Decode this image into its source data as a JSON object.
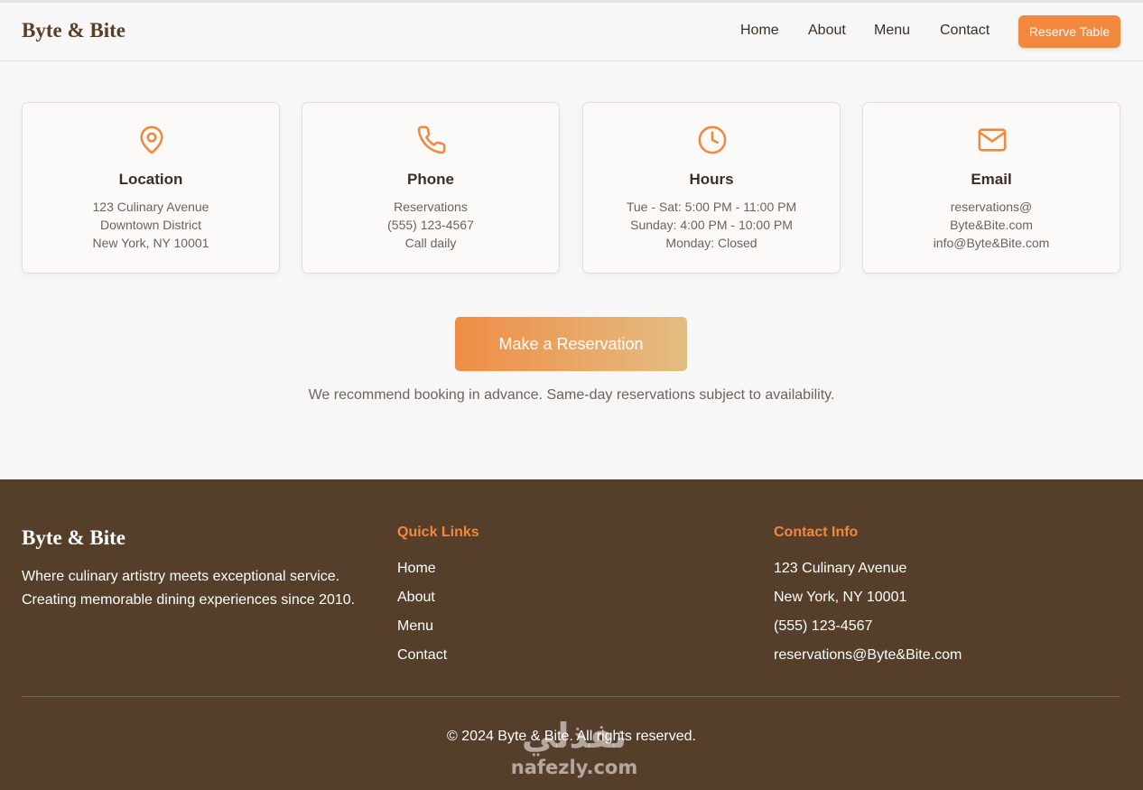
{
  "header": {
    "brand": "Byte & Bite",
    "nav": [
      "Home",
      "About",
      "Menu",
      "Contact"
    ],
    "reserve_label": "Reserve Table"
  },
  "cards": [
    {
      "icon": "map-pin-icon",
      "title": "Location",
      "lines": [
        "123 Culinary Avenue",
        "Downtown District",
        "New York, NY 10001"
      ]
    },
    {
      "icon": "phone-icon",
      "title": "Phone",
      "lines": [
        "Reservations",
        "(555) 123-4567",
        "Call daily"
      ]
    },
    {
      "icon": "clock-icon",
      "title": "Hours",
      "lines": [
        "Tue - Sat: 5:00 PM - 11:00 PM",
        "Sunday: 4:00 PM - 10:00 PM",
        "Monday: Closed"
      ]
    },
    {
      "icon": "mail-icon",
      "title": "Email",
      "lines": [
        "reservations@",
        "Byte&Bite.com",
        "info@Byte&Bite.com"
      ]
    }
  ],
  "cta": {
    "label": "Make a Reservation",
    "note": "We recommend booking in advance. Same-day reservations subject to availability."
  },
  "footer": {
    "brand": "Byte & Bite",
    "tagline": [
      "Where culinary artistry meets exceptional service.",
      "Creating memorable dining experiences since 2010."
    ],
    "quick_links_title": "Quick Links",
    "quick_links": [
      "Home",
      "About",
      "Menu",
      "Contact"
    ],
    "contact_title": "Contact Info",
    "contact": [
      "123 Culinary Avenue",
      "New York, NY 10001",
      "(555) 123-4567",
      "reservations@Byte&Bite.com"
    ],
    "copyright": "© 2024 Byte & Bite. All rights reserved."
  },
  "watermark": {
    "arabic": "نفذلي",
    "latin": "nafezly.com"
  },
  "colors": {
    "accent": "#f0883e",
    "footer_bg": "#563f2a",
    "page_bg": "#f8f7f7"
  }
}
